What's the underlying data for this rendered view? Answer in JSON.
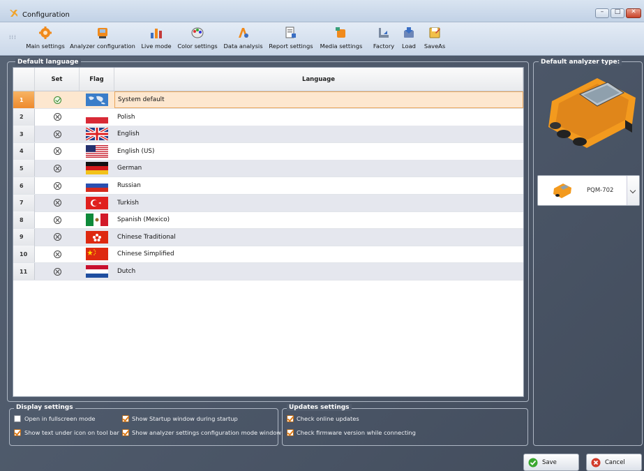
{
  "window": {
    "title": "Configuration",
    "minimize": "–",
    "maximize": "□",
    "close": "✕"
  },
  "toolbar": {
    "items": [
      {
        "label": "Main settings",
        "icon": "gear-icon"
      },
      {
        "label": "Analyzer configuration",
        "icon": "analyzer-icon"
      },
      {
        "label": "Live mode",
        "icon": "bar-chart-icon"
      },
      {
        "label": "Color settings",
        "icon": "palette-icon"
      },
      {
        "label": "Data analysis",
        "icon": "analysis-icon"
      },
      {
        "label": "Report settings",
        "icon": "report-icon"
      },
      {
        "label": "Media settings",
        "icon": "media-icon"
      },
      {
        "label": "Factory",
        "icon": "factory-icon"
      },
      {
        "label": "Load",
        "icon": "load-icon"
      },
      {
        "label": "SaveAs",
        "icon": "saveas-icon"
      }
    ]
  },
  "language_panel": {
    "legend": "Default language",
    "headers": {
      "set": "Set",
      "flag": "Flag",
      "language": "Language"
    },
    "rows": [
      {
        "num": "1",
        "set": true,
        "flag": "world",
        "language": "System default"
      },
      {
        "num": "2",
        "set": false,
        "flag": "pl",
        "language": "Polish"
      },
      {
        "num": "3",
        "set": false,
        "flag": "gb",
        "language": "English"
      },
      {
        "num": "4",
        "set": false,
        "flag": "us",
        "language": "English (US)"
      },
      {
        "num": "5",
        "set": false,
        "flag": "de",
        "language": "German"
      },
      {
        "num": "6",
        "set": false,
        "flag": "ru",
        "language": "Russian"
      },
      {
        "num": "7",
        "set": false,
        "flag": "tr",
        "language": "Turkish"
      },
      {
        "num": "8",
        "set": false,
        "flag": "mx",
        "language": "Spanish (Mexico)"
      },
      {
        "num": "9",
        "set": false,
        "flag": "hk",
        "language": "Chinese Traditional"
      },
      {
        "num": "10",
        "set": false,
        "flag": "cn",
        "language": "Chinese Simplified"
      },
      {
        "num": "11",
        "set": false,
        "flag": "nl",
        "language": "Dutch"
      }
    ]
  },
  "display_settings": {
    "legend": "Display settings",
    "options": [
      {
        "label": "Open in fullscreen mode",
        "checked": false
      },
      {
        "label": "Show Startup window during startup",
        "checked": true
      },
      {
        "label": "Show text under icon on tool bar",
        "checked": true
      },
      {
        "label": "Show analyzer settings configuration mode window",
        "checked": true
      }
    ]
  },
  "updates_settings": {
    "legend": "Updates settings",
    "options": [
      {
        "label": "Check online updates",
        "checked": true
      },
      {
        "label": "Check firmware version while connecting",
        "checked": true
      }
    ]
  },
  "analyzer_panel": {
    "legend": "Default analyzer type:",
    "selected": "PQM-702"
  },
  "buttons": {
    "save": "Save",
    "cancel": "Cancel"
  },
  "colors": {
    "accent": "#ee8a2d",
    "background": "#4a5566",
    "selected_row": "#fde7cf"
  }
}
